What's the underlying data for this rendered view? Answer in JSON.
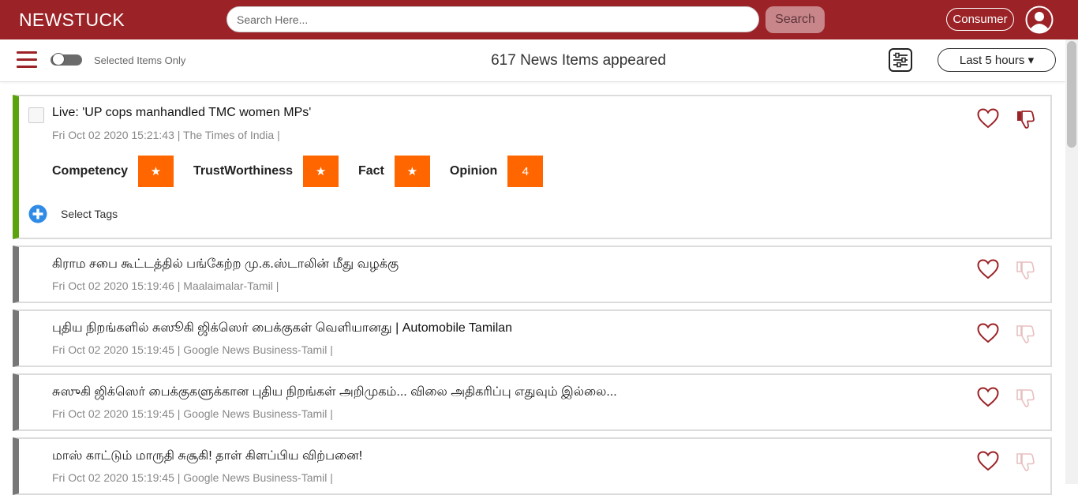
{
  "header": {
    "brand": "NEWSTUCK",
    "search_placeholder": "Search Here...",
    "search_button": "Search",
    "mode_button": "Consumer",
    "user_icon": "user-circle-icon",
    "bg_color": "#9b2226"
  },
  "toolbar": {
    "menu_icon": "hamburger-menu-icon",
    "selected_only_label": "Selected Items Only",
    "count_text": "617 News Items appeared",
    "filter_icon": "filter-sliders-icon",
    "time_filter": "Last 5 hours"
  },
  "expanded_item": {
    "title": "Live: 'UP cops manhandled TMC women MPs'",
    "meta": "Fri Oct 02 2020 15:21:43  | The Times of India |",
    "ratings": [
      {
        "label": "Competency",
        "value": "★"
      },
      {
        "label": "TrustWorthiness",
        "value": "★"
      },
      {
        "label": "Fact",
        "value": "★"
      },
      {
        "label": "Opinion",
        "value": "4"
      }
    ],
    "tags_label": "Select Tags",
    "accent": "#5aa20e"
  },
  "items": [
    {
      "title": "கிராம சபை கூட்டத்தில் பங்கேற்ற மு.க.ஸ்டாலின் மீது வழக்கு",
      "meta": "Fri Oct 02 2020 15:19:46  | Maalaimalar-Tamil |"
    },
    {
      "title": "புதிய நிறங்களில் சுஸூகி ஜிக்ஸெர் பைக்குகள் வெளியானது | Automobile Tamilan",
      "meta": "Fri Oct 02 2020 15:19:45  | Google News Business-Tamil |"
    },
    {
      "title": "சுஸுகி ஜிக்ஸெர் பைக்குகளுக்கான புதிய நிறங்கள் அறிமுகம்... விலை அதிகரிப்பு எதுவும் இல்லை...",
      "meta": "Fri Oct 02 2020 15:19:45  | Google News Business-Tamil |"
    },
    {
      "title": "மாஸ் காட்டும் மாருதி சுசூகி! தாள் கிளப்பிய விற்பனை!",
      "meta": "Fri Oct 02 2020 15:19:45  | Google News Business-Tamil |"
    }
  ],
  "colors": {
    "rating_box": "#ff6600",
    "heart": "#9b2226",
    "add_tag": "#2f8be6"
  }
}
